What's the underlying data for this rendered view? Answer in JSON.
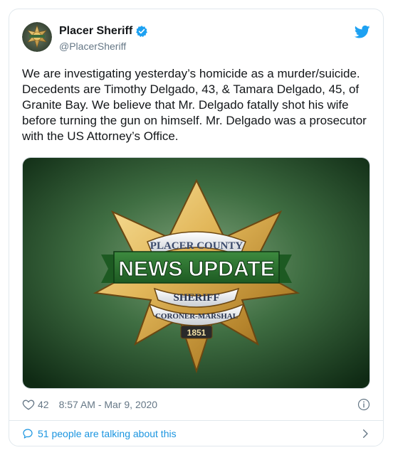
{
  "account": {
    "display_name": "Placer Sheriff",
    "handle": "@PlacerSheriff",
    "avatar_icon": "sheriff-badge-avatar",
    "verified_icon": "verified-badge-icon"
  },
  "tweet": {
    "text": "We are investigating yesterday’s homicide as a murder/suicide. Decedents are Timothy Delgado, 43, & Tamara Delgado, 45, of Granite Bay. We believe that Mr. Delgado fatally shot his wife before turning the gun on himself. Mr. Delgado was a prosecutor with the US Attorney’s Office."
  },
  "media": {
    "badge_top_text": "PLACER COUNTY",
    "banner_text": "NEWS UPDATE",
    "badge_sheriff_text": "SHERIFF",
    "badge_bottom_text": "CORONER-MARSHAL",
    "badge_year": "1851"
  },
  "meta": {
    "like_count": "42",
    "timestamp": "8:57 AM - Mar 9, 2020"
  },
  "conversation": {
    "label": "51 people are talking about this"
  },
  "colors": {
    "accent": "#1da1f2",
    "link": "#1b95e0",
    "secondary_text": "#657786",
    "border": "#e1e8ed"
  }
}
